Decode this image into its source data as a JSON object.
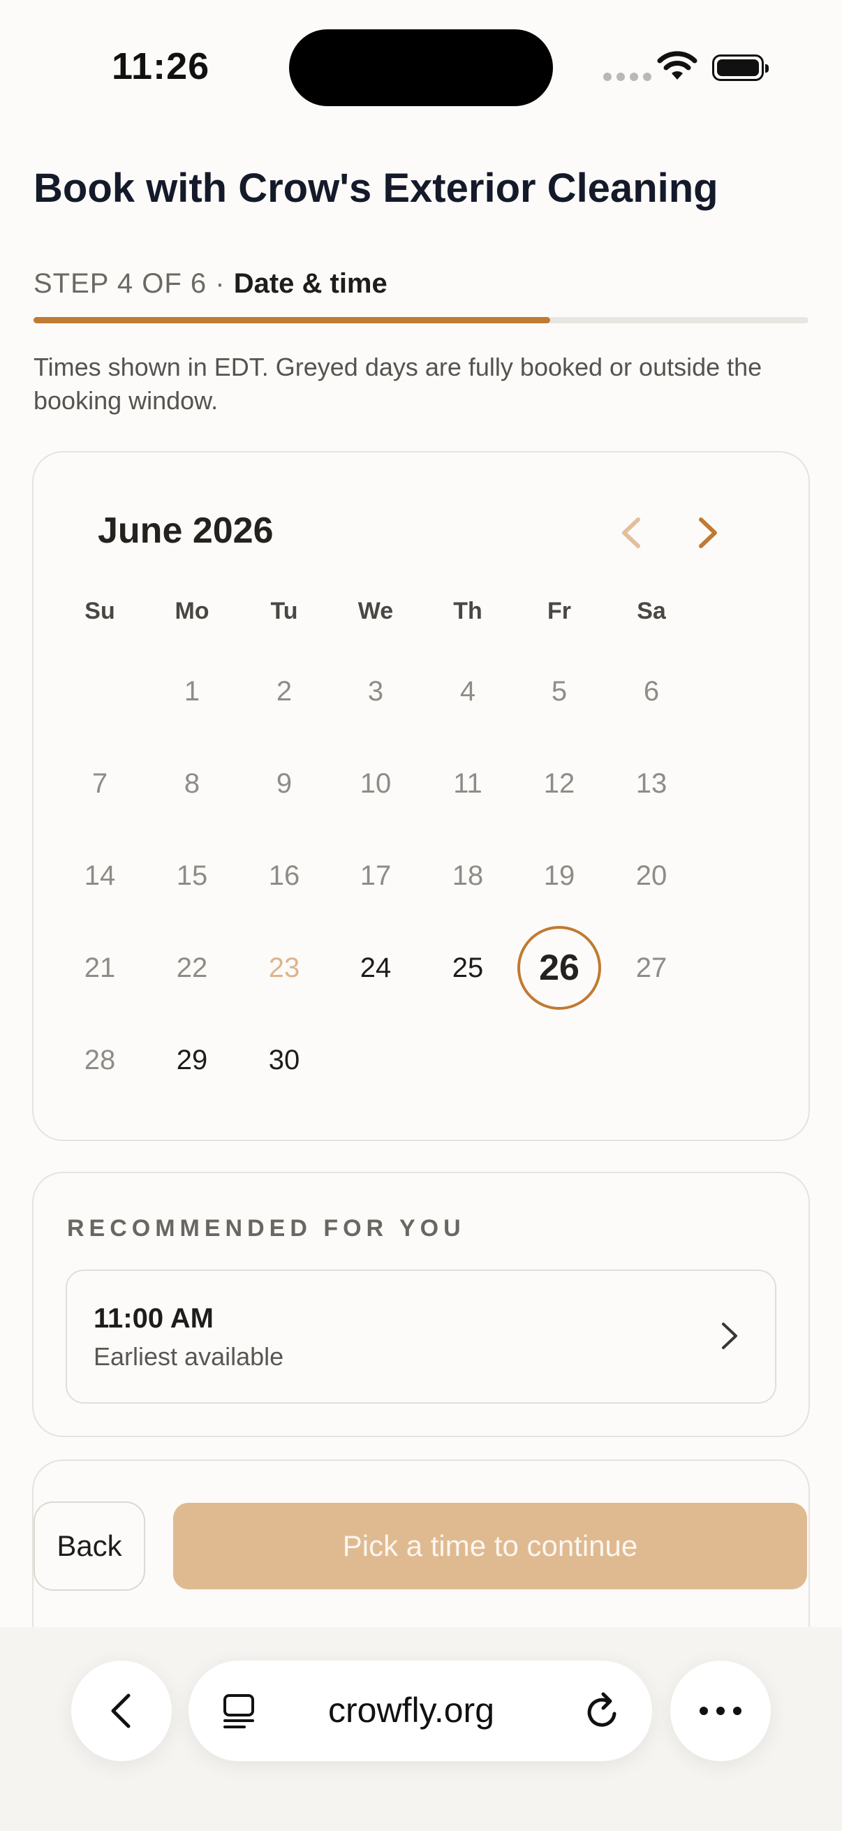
{
  "status_bar": {
    "time": "11:26"
  },
  "header": {
    "title": "Book with Crow's Exterior Cleaning"
  },
  "progress": {
    "step_label": "STEP 4 OF 6 ·",
    "step_name": "Date & time",
    "fraction": 0.6667,
    "accent_color": "#c07a32"
  },
  "note": "Times shown in EDT. Greyed days are fully booked or outside the booking window.",
  "calendar": {
    "month_label": "June 2026",
    "prev_icon": "chevron-left-icon",
    "next_icon": "chevron-right-icon",
    "weekdays": [
      "Su",
      "Mo",
      "Tu",
      "We",
      "Th",
      "Fr",
      "Sa"
    ],
    "days": [
      "1",
      "2",
      "3",
      "4",
      "5",
      "6",
      "7",
      "8",
      "9",
      "10",
      "11",
      "12",
      "13",
      "14",
      "15",
      "16",
      "17",
      "18",
      "19",
      "20",
      "21",
      "22",
      "23",
      "24",
      "25",
      "26",
      "27",
      "28",
      "29",
      "30"
    ],
    "today": "23",
    "selected": "26",
    "available": [
      "24",
      "25",
      "26",
      "29",
      "30"
    ]
  },
  "recommended": {
    "heading": "RECOMMENDED FOR YOU",
    "slot_time": "11:00 AM",
    "slot_sub": "Earliest available"
  },
  "footer": {
    "back_label": "Back",
    "continue_label": "Pick a time to continue"
  },
  "browser": {
    "url": "crowfly.org"
  }
}
